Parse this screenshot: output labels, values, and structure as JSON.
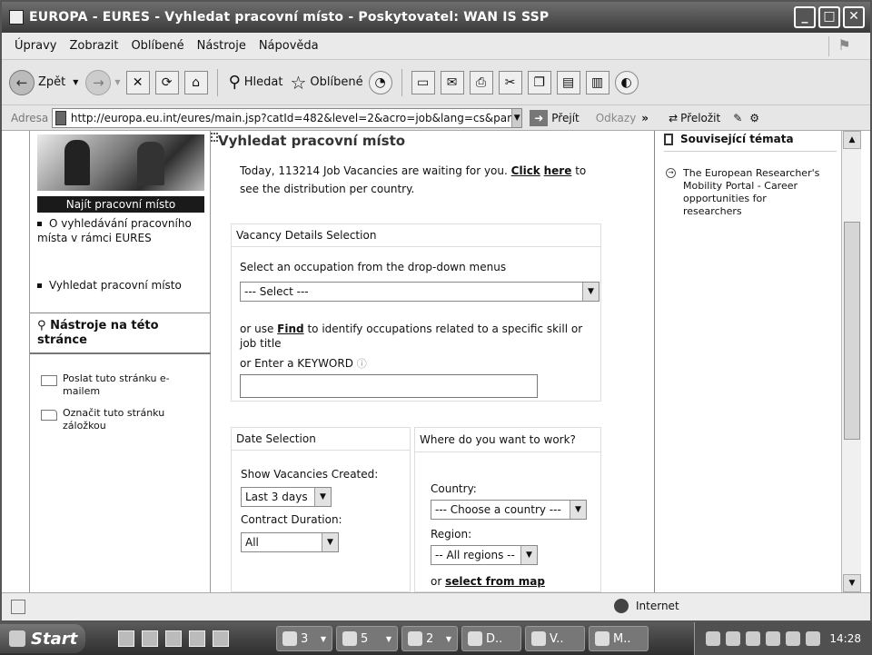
{
  "window": {
    "title": "EUROPA - EURES - Vyhledat pracovní místo - Poskytovatel: WAN IS SSP",
    "min_icon": "_",
    "max_icon": "□",
    "close_icon": "✕"
  },
  "menu": [
    "Úpravy",
    "Zobrazit",
    "Oblíbené",
    "Nástroje",
    "Nápověda"
  ],
  "toolbar": {
    "back": "Zpět",
    "search": "Hledat",
    "favorites": "Oblíbené"
  },
  "address": {
    "label": "Adresa",
    "url": "http://europa.eu.int/eures/main.jsp?catId=482&level=2&acro=job&lang=cs&par",
    "go": "Přejít",
    "links": "Odkazy",
    "chevron": "»",
    "translate": "Přeložit"
  },
  "left": {
    "hero_label": "Najít pracovní místo",
    "nav": [
      "O vyhledávání pracovního místa v rámci EURES",
      "Vyhledat pracovní místo"
    ],
    "tools_title": "Nástroje na této stránce",
    "tools": [
      "Poslat tuto stránku e-mailem",
      "Označit tuto stránku záložkou"
    ]
  },
  "main": {
    "page_title": "Vyhledat pracovní místo",
    "intro_text": "Today, 113214 Job Vacancies are waiting for you.",
    "intro_link1": "Click",
    "intro_link2": "here",
    "intro_rest": "to see the distribution per country.",
    "vacancy_panel": {
      "title": "Vacancy Details Selection",
      "occupation_label": "Select an occupation from the drop-down menus",
      "occupation_value": "--- Select ---",
      "or_use": "or use",
      "find_link": "Find",
      "find_rest": "to identify occupations related to a specific skill or job title",
      "keyword_label": "or Enter a KEYWORD",
      "keyword_value": ""
    },
    "date_panel": {
      "title": "Date Selection",
      "created_label": "Show Vacancies Created:",
      "created_value": "Last 3 days",
      "duration_label": "Contract Duration:",
      "duration_value": "All"
    },
    "where_panel": {
      "title": "Where do you want to work?",
      "country_label": "Country:",
      "country_value": "--- Choose a country ---",
      "region_label": "Region:",
      "region_value": "-- All regions --",
      "or_text": "or",
      "map_link": "select from map"
    }
  },
  "right": {
    "title": "Související témata",
    "item": "The European Researcher's Mobility Portal - Career opportunities for researchers"
  },
  "status": {
    "zone": "Internet"
  },
  "taskbar": {
    "start": "Start",
    "buttons": [
      "3",
      "5",
      "2",
      "D..",
      "V..",
      "M.."
    ],
    "clock": "14:28"
  }
}
